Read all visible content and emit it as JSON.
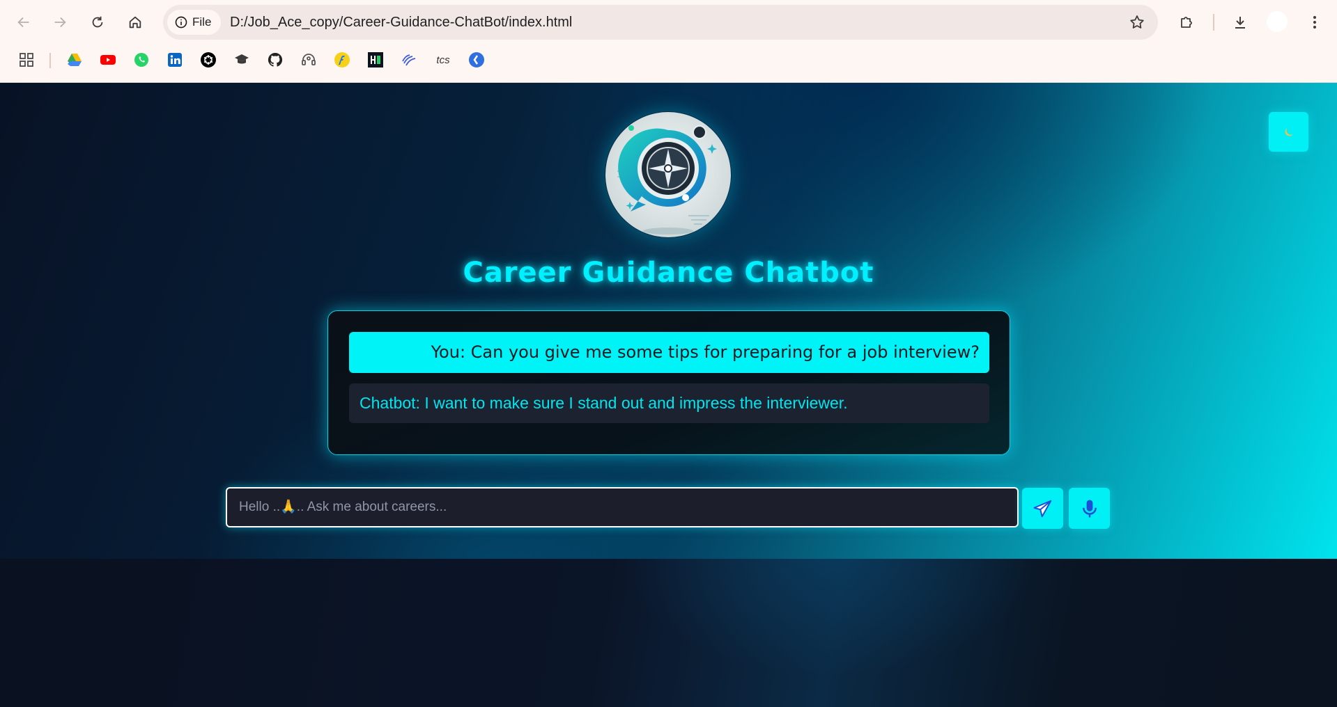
{
  "browser": {
    "site_chip_label": "File",
    "url": "D:/Job_Ace_copy/Career-Guidance-ChatBot/index.html"
  },
  "bookmarks": [
    {
      "name": "apps-grid-icon"
    },
    {
      "name": "google-drive-icon"
    },
    {
      "name": "youtube-icon"
    },
    {
      "name": "whatsapp-icon"
    },
    {
      "name": "linkedin-icon"
    },
    {
      "name": "openai-icon"
    },
    {
      "name": "graduation-cap-icon"
    },
    {
      "name": "github-icon"
    },
    {
      "name": "headset-icon"
    },
    {
      "name": "flipkart-icon"
    },
    {
      "name": "hackerrank-icon"
    },
    {
      "name": "stripes-icon"
    },
    {
      "name": "tcs-icon",
      "label": "tcs"
    },
    {
      "name": "blue-circle-icon"
    }
  ],
  "page": {
    "title": "Career Guidance Chatbot",
    "theme_toggle_icon": "moon-icon",
    "messages": [
      {
        "role": "user",
        "text": "You: Can you give me some tips for preparing for a job interview?"
      },
      {
        "role": "bot",
        "text": "Chatbot: I want to make sure I stand out and impress the interviewer."
      }
    ],
    "input_placeholder": "Hello ..🙏.. Ask me about careers...",
    "send_icon": "send-icon",
    "mic_icon": "microphone-icon"
  },
  "colors": {
    "accent": "#00f0f5",
    "title": "#00f0ff",
    "bot_text": "#00e6ef",
    "bot_bg": "#1c2230",
    "chrome_bg": "#fdf6f3"
  }
}
